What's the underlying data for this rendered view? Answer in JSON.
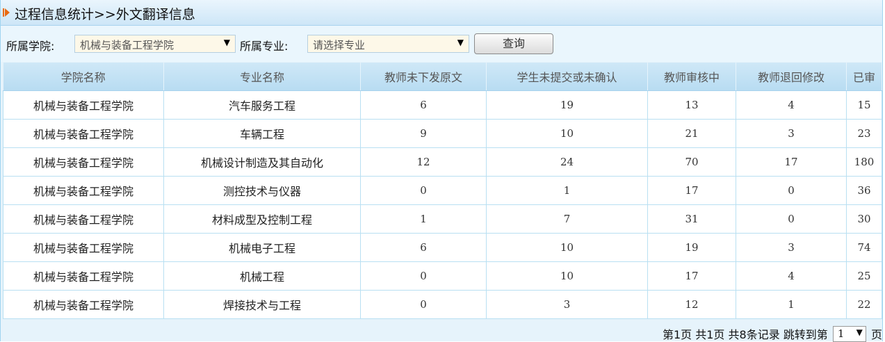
{
  "title": "过程信息统计>>外文翻译信息",
  "filters": {
    "college_label": "所属学院:",
    "college_value": "机械与装备工程学院",
    "major_label": "所属专业:",
    "major_placeholder": "请选择专业",
    "query_label": "查询"
  },
  "table": {
    "headers": [
      "学院名称",
      "专业名称",
      "教师未下发原文",
      "学生未提交或未确认",
      "教师审核中",
      "教师退回修改",
      "已审"
    ],
    "rows": [
      [
        "机械与装备工程学院",
        "汽车服务工程",
        "6",
        "19",
        "13",
        "4",
        "15"
      ],
      [
        "机械与装备工程学院",
        "车辆工程",
        "9",
        "10",
        "21",
        "3",
        "23"
      ],
      [
        "机械与装备工程学院",
        "机械设计制造及其自动化",
        "12",
        "24",
        "70",
        "17",
        "180"
      ],
      [
        "机械与装备工程学院",
        "测控技术与仪器",
        "0",
        "1",
        "17",
        "0",
        "36"
      ],
      [
        "机械与装备工程学院",
        "材料成型及控制工程",
        "1",
        "7",
        "31",
        "0",
        "30"
      ],
      [
        "机械与装备工程学院",
        "机械电子工程",
        "6",
        "10",
        "19",
        "3",
        "74"
      ],
      [
        "机械与装备工程学院",
        "机械工程",
        "0",
        "10",
        "17",
        "4",
        "25"
      ],
      [
        "机械与装备工程学院",
        "焊接技术与工程",
        "0",
        "3",
        "12",
        "1",
        "22"
      ]
    ]
  },
  "pagination": {
    "summary": "第1页 共1页 共8条记录 跳转到第",
    "page_value": "1",
    "suffix": "页"
  }
}
